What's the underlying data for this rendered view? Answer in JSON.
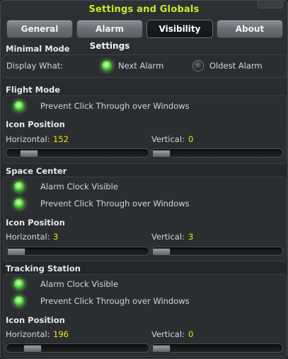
{
  "window": {
    "title": "Settings and Globals"
  },
  "tabs": [
    {
      "label": "General",
      "active": false
    },
    {
      "label": "Alarm Settings",
      "active": false
    },
    {
      "label": "Visibility",
      "active": true
    },
    {
      "label": "About",
      "active": false
    }
  ],
  "minimal_mode": {
    "heading": "Minimal Mode",
    "display_label": "Display What:",
    "options": [
      {
        "label": "Next Alarm",
        "selected": true
      },
      {
        "label": "Oldest Alarm",
        "selected": false
      }
    ]
  },
  "flight_mode": {
    "heading": "Flight Mode",
    "prevent_click_label": "Prevent Click Through over Windows",
    "prevent_click_on": true,
    "icon_position": {
      "heading": "Icon Position",
      "horizontal_label": "Horizontal:",
      "horizontal_value": "152",
      "vertical_label": "Vertical:",
      "vertical_value": "0",
      "horizontal_slider_fraction": 0.1,
      "vertical_slider_fraction": 0.0
    }
  },
  "space_center": {
    "heading": "Space Center",
    "alarm_clock_label": "Alarm Clock Visible",
    "alarm_clock_on": true,
    "prevent_click_label": "Prevent Click Through over Windows",
    "prevent_click_on": true,
    "icon_position": {
      "heading": "Icon Position",
      "horizontal_label": "Horizontal:",
      "horizontal_value": "3",
      "vertical_label": "Vertical:",
      "vertical_value": "3",
      "horizontal_slider_fraction": 0.0,
      "vertical_slider_fraction": 0.0
    }
  },
  "tracking_station": {
    "heading": "Tracking Station",
    "alarm_clock_label": "Alarm Clock Visible",
    "alarm_clock_on": true,
    "prevent_click_label": "Prevent Click Through over Windows",
    "prevent_click_on": true,
    "icon_position": {
      "heading": "Icon Position",
      "horizontal_label": "Horizontal:",
      "horizontal_value": "196",
      "vertical_label": "Vertical:",
      "vertical_value": "0",
      "horizontal_slider_fraction": 0.13,
      "vertical_slider_fraction": 0.0
    }
  },
  "colors": {
    "title": "#c8ec2a",
    "value": "#f2e600",
    "led_on": "#86f06a"
  }
}
